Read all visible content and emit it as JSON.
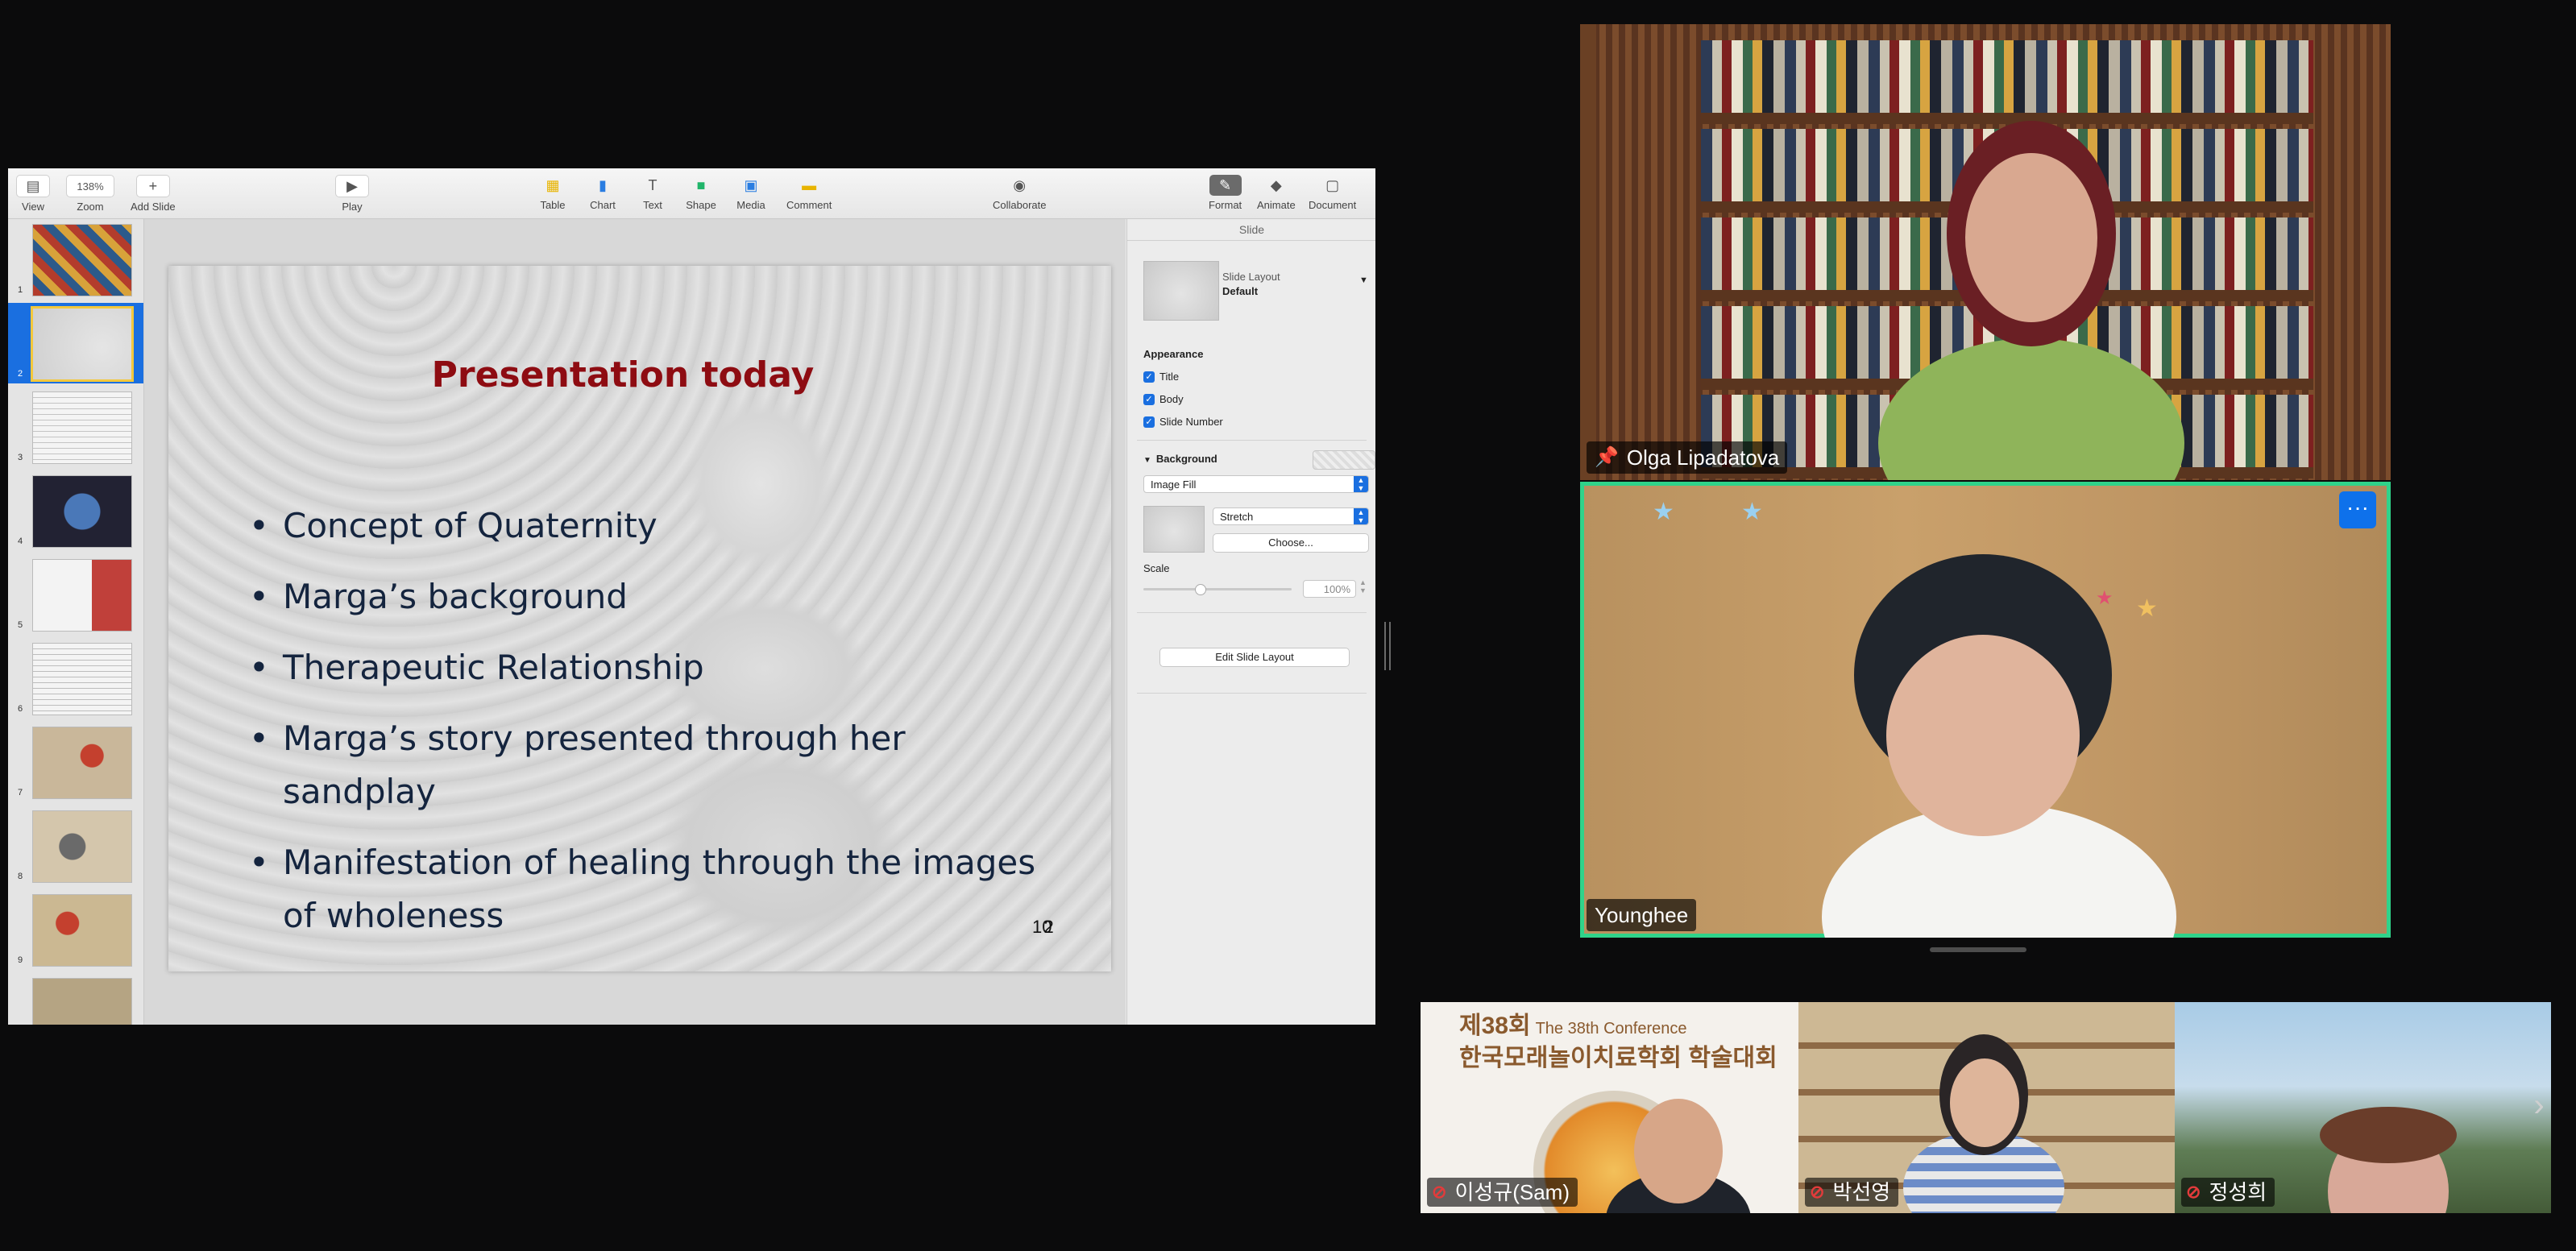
{
  "keynote": {
    "toolbar": {
      "view": "View",
      "zoom_value": "138%",
      "zoom": "Zoom",
      "add_slide": "Add Slide",
      "play": "Play",
      "table": "Table",
      "chart": "Chart",
      "text": "Text",
      "shape": "Shape",
      "media": "Media",
      "comment": "Comment",
      "collaborate": "Collaborate",
      "format": "Format",
      "animate": "Animate",
      "document": "Document"
    },
    "navigator": {
      "numbers": [
        "1",
        "2",
        "3",
        "4",
        "5",
        "6",
        "7",
        "8",
        "9"
      ],
      "selected": 2
    },
    "slide": {
      "title": "Presentation today",
      "bullets": [
        "Concept of Quaternity",
        "Marga’s background",
        "Therapeutic Relationship",
        "Marga’s story presented through her sandplay",
        "Manifestation of healing through the images of wholeness"
      ],
      "number": "10",
      "number_overlay": "2"
    },
    "inspector": {
      "tab": "Slide",
      "layout_label": "Slide Layout",
      "layout_value": "Default",
      "appearance": "Appearance",
      "chk_title": "Title",
      "chk_body": "Body",
      "chk_slide_number": "Slide Number",
      "background": "Background",
      "fill_type": "Image Fill",
      "stretch": "Stretch",
      "choose": "Choose...",
      "scale": "Scale",
      "scale_value": "100%",
      "edit_layout": "Edit Slide Layout"
    }
  },
  "participants": {
    "olga": "Olga Lipadatova",
    "younghee": "Younghee",
    "more": "···"
  },
  "strip": {
    "conf_line1": "제38회",
    "conf_line1_en": "The 38th Conference",
    "conf_line2": "한국모래놀이치료학회 학술대회",
    "names": [
      "이성규(Sam)",
      "박선영",
      "정성희"
    ]
  },
  "colors": {
    "active_speaker": "#2fd38a",
    "selection": "#1a6fe0",
    "slide_title": "#8e0c12",
    "slide_text": "#14243e"
  }
}
